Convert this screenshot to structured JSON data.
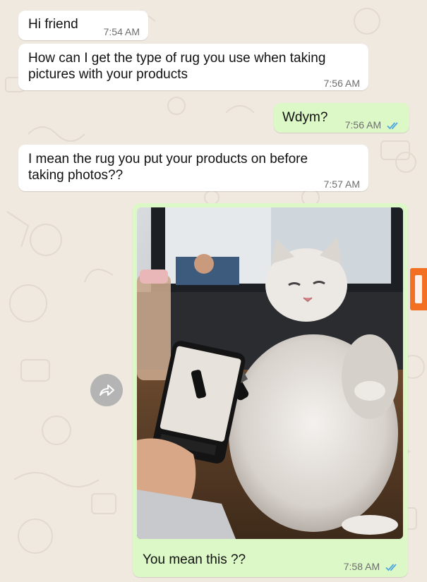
{
  "messages": [
    {
      "id": "m1",
      "direction": "incoming",
      "text_lines": [
        "Hi friend"
      ],
      "time": "7:54 AM"
    },
    {
      "id": "m2",
      "direction": "incoming",
      "text_lines": [
        "How can I get the type of rug you use when taking",
        "pictures with your products"
      ],
      "time": "7:56 AM"
    },
    {
      "id": "m3",
      "direction": "outgoing",
      "text_lines": [
        "Wdym?"
      ],
      "time": "7:56 AM",
      "status": "read"
    },
    {
      "id": "m4",
      "direction": "incoming",
      "text_lines": [
        "I mean the rug you put your products on before",
        "taking photos??"
      ],
      "time": "7:57 AM"
    },
    {
      "id": "m5",
      "direction": "outgoing",
      "type": "photo",
      "caption": "You mean this ??",
      "time": "7:58 AM",
      "status": "read"
    }
  ],
  "forward_button": {
    "icon": "forward-arrow-icon"
  },
  "watermark": {
    "icon": "jeja-logo"
  },
  "colors": {
    "incoming_bubble": "#ffffff",
    "outgoing_bubble": "#dcf8c6",
    "read_ticks": "#4fa6e0",
    "chat_background": "#efe9df",
    "watermark": "#f36f21"
  }
}
